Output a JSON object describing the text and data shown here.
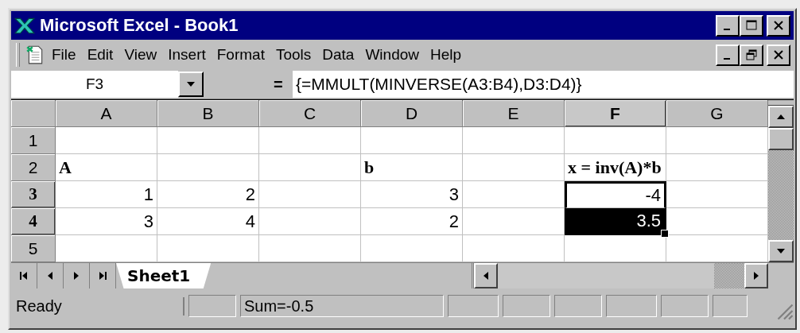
{
  "window": {
    "title": "Microsoft Excel - Book1"
  },
  "menu": [
    "File",
    "Edit",
    "View",
    "Insert",
    "Format",
    "Tools",
    "Data",
    "Window",
    "Help"
  ],
  "formula_bar": {
    "name_box": "F3",
    "equals": "=",
    "formula": "{=MMULT(MINVERSE(A3:B4),D3:D4)}"
  },
  "columns": [
    {
      "label": "A",
      "selected": false
    },
    {
      "label": "B",
      "selected": false
    },
    {
      "label": "C",
      "selected": false
    },
    {
      "label": "D",
      "selected": false
    },
    {
      "label": "E",
      "selected": false
    },
    {
      "label": "F",
      "selected": true
    },
    {
      "label": "G",
      "selected": false
    }
  ],
  "rows": [
    {
      "label": "1",
      "selected": false,
      "cells": [
        null,
        null,
        null,
        null,
        null,
        null,
        null
      ]
    },
    {
      "label": "2",
      "selected": false,
      "cells": [
        {
          "text": "A",
          "kind": "label",
          "selected": false,
          "highlighted": false
        },
        null,
        null,
        {
          "text": "b",
          "kind": "label",
          "selected": false,
          "highlighted": false
        },
        null,
        {
          "text": "x = inv(A)*b",
          "kind": "label",
          "selected": false,
          "highlighted": false
        },
        null
      ]
    },
    {
      "label": "3",
      "selected": true,
      "cells": [
        {
          "text": "1",
          "kind": "number",
          "selected": false,
          "highlighted": false
        },
        {
          "text": "2",
          "kind": "number",
          "selected": false,
          "highlighted": false
        },
        null,
        {
          "text": "3",
          "kind": "number",
          "selected": false,
          "highlighted": false
        },
        null,
        {
          "text": "-4",
          "kind": "number",
          "selected": true,
          "highlighted": false
        },
        null
      ]
    },
    {
      "label": "4",
      "selected": true,
      "cells": [
        {
          "text": "3",
          "kind": "number",
          "selected": false,
          "highlighted": false
        },
        {
          "text": "4",
          "kind": "number",
          "selected": false,
          "highlighted": false
        },
        null,
        {
          "text": "2",
          "kind": "number",
          "selected": false,
          "highlighted": false
        },
        null,
        {
          "text": "3.5",
          "kind": "number",
          "selected": true,
          "highlighted": true
        },
        null
      ]
    },
    {
      "label": "5",
      "selected": false,
      "cells": [
        null,
        null,
        null,
        null,
        null,
        null,
        null
      ]
    }
  ],
  "sheet_tabs": [
    {
      "label": "Sheet1",
      "selected": true
    }
  ],
  "status_bar": {
    "mode": "Ready",
    "sum": "Sum=-0.5"
  }
}
